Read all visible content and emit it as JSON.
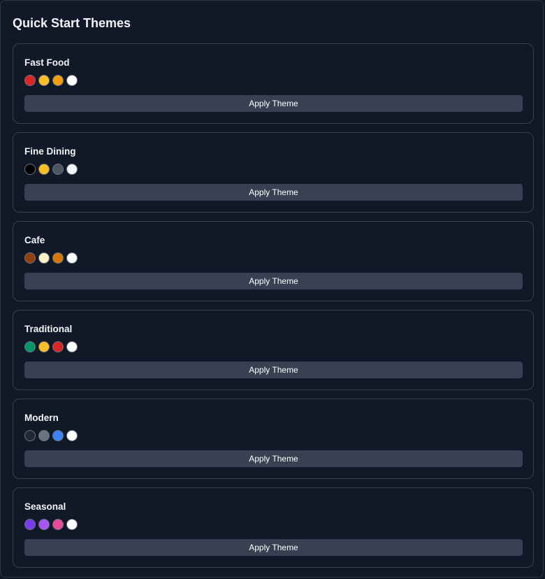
{
  "panel": {
    "title": "Quick Start Themes"
  },
  "themes": [
    {
      "name": "Fast Food",
      "colors": [
        "#dc2626",
        "#fbbf24",
        "#f59e0b",
        "#ffffff"
      ],
      "button_label": "Apply Theme"
    },
    {
      "name": "Fine Dining",
      "colors": [
        "#000000",
        "#fbbf24",
        "#4b5563",
        "#f3f4f6"
      ],
      "button_label": "Apply Theme"
    },
    {
      "name": "Cafe",
      "colors": [
        "#92400e",
        "#fef3c7",
        "#d97706",
        "#ffffff"
      ],
      "button_label": "Apply Theme"
    },
    {
      "name": "Traditional",
      "colors": [
        "#059669",
        "#fbbf24",
        "#dc2626",
        "#ffffff"
      ],
      "button_label": "Apply Theme"
    },
    {
      "name": "Modern",
      "colors": [
        "#1f2937",
        "#6b7280",
        "#3b82f6",
        "#ffffff"
      ],
      "button_label": "Apply Theme"
    },
    {
      "name": "Seasonal",
      "colors": [
        "#7c3aed",
        "#a855f7",
        "#ec4899",
        "#ffffff"
      ],
      "button_label": "Apply Theme"
    }
  ]
}
